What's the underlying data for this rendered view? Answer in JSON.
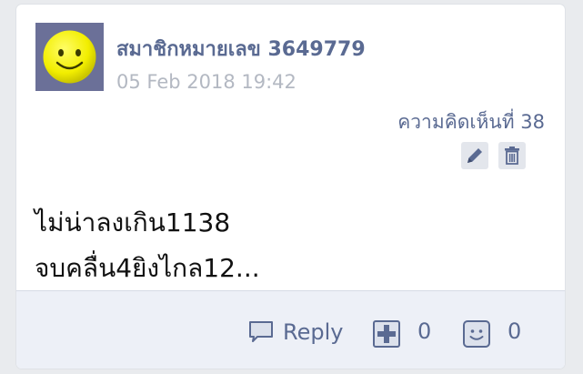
{
  "post": {
    "username": "สมาชิกหมายเลข 3649779",
    "timestamp": "05 Feb 2018 19:42",
    "comment_number": "ความคิดเห็นที่ 38",
    "body_lines": [
      "ไม่น่าลงเกิน1138",
      "จบคลื่น4ยิงไกล12..."
    ]
  },
  "actions": {
    "edit_icon": "pencil-icon",
    "delete_icon": "trash-icon"
  },
  "footer": {
    "reply_label": "Reply",
    "plus_count": "0",
    "emoji_count": "0"
  },
  "colors": {
    "accent": "#5a6a92",
    "muted": "#b3b8c2",
    "footer_bg": "#edf0f7",
    "avatar_bg": "#6b7098",
    "avatar_face": "#f2ee00"
  }
}
